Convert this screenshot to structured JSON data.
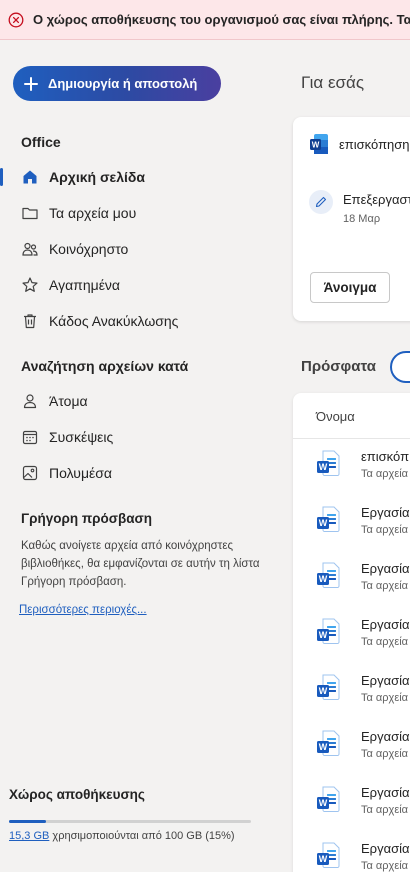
{
  "banner": {
    "text": "Ο χώρος αποθήκευσης του οργανισμού σας είναι πλήρης. Τα αρχεία δεν συγχρονίζονται.",
    "icon": "error-circle-icon",
    "color": "#c50f1f"
  },
  "sidebar": {
    "create_label": "Δημιουργία ή αποστολή",
    "office_section": "Office",
    "office_items": [
      {
        "label": "Αρχική σελίδα",
        "icon": "home-icon"
      },
      {
        "label": "Τα αρχεία μου",
        "icon": "folder-icon"
      },
      {
        "label": "Κοινόχρηστο",
        "icon": "people-icon"
      },
      {
        "label": "Αγαπημένα",
        "icon": "star-icon"
      },
      {
        "label": "Κάδος Ανακύκλωσης",
        "icon": "trash-icon"
      }
    ],
    "browse_section": "Αναζήτηση αρχείων κατά",
    "browse_items": [
      {
        "label": "Άτομα",
        "icon": "person-icon"
      },
      {
        "label": "Συσκέψεις",
        "icon": "calendar-icon"
      },
      {
        "label": "Πολυμέσα",
        "icon": "image-icon"
      }
    ],
    "quick_access": {
      "title": "Γρήγορη πρόσβαση",
      "description": "Καθώς ανοίγετε αρχεία από κοινόχρηστες βιβλιοθήκες, θα εμφανίζονται σε αυτήν τη λίστα Γρήγορη πρόσβαση.",
      "more_link": "Περισσότερες περιοχές..."
    },
    "storage": {
      "title": "Χώρος αποθήκευσης",
      "used": "15,3 GB",
      "rest": " χρησιμοποιούνται από 100 GB (15%)",
      "fraction": 0.153
    }
  },
  "main": {
    "for_you": "Για εσάς",
    "card": {
      "doc_title": "επισκόπηση",
      "activity": "Επεξεργαστ",
      "date": "18 Μαρ",
      "open_label": "Άνοιγμα"
    },
    "recent_title": "Πρόσφατα",
    "column_name": "Όνομα",
    "files": [
      {
        "name": "επισκόπ",
        "location": "Τα αρχεία"
      },
      {
        "name": "Εργασία",
        "location": "Τα αρχεία"
      },
      {
        "name": "Εργασία",
        "location": "Τα αρχεία"
      },
      {
        "name": "Εργασία",
        "location": "Τα αρχεία"
      },
      {
        "name": "Εργασία",
        "location": "Τα αρχεία"
      },
      {
        "name": "Εργασία",
        "location": "Τα αρχεία"
      },
      {
        "name": "Εργασία",
        "location": "Τα αρχεία"
      },
      {
        "name": "Εργασία",
        "location": "Τα αρχεία"
      }
    ]
  },
  "colors": {
    "accent": "#1f5fbf",
    "word_blue": "#185abd",
    "error": "#c50f1f"
  }
}
